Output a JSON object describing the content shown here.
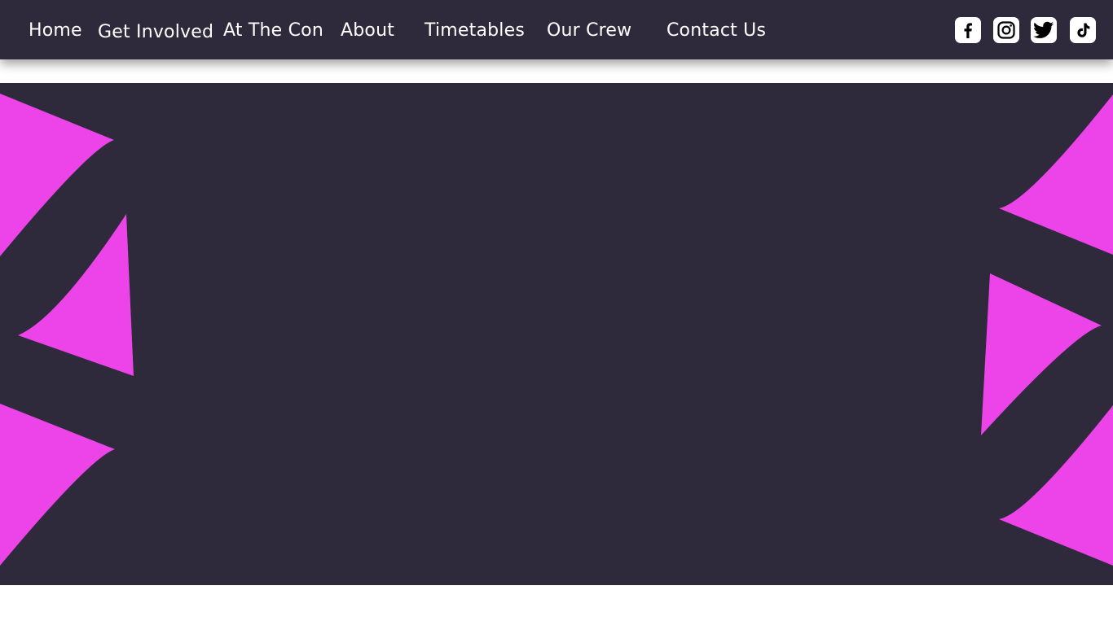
{
  "nav": {
    "items": [
      {
        "label": "Home"
      },
      {
        "label": "Get Involved"
      },
      {
        "label": "At The Con"
      },
      {
        "label": "About"
      },
      {
        "label": "Timetables"
      },
      {
        "label": "Our Crew"
      },
      {
        "label": "Contact Us"
      }
    ]
  },
  "social": [
    {
      "icon": "facebook-icon"
    },
    {
      "icon": "instagram-icon"
    },
    {
      "icon": "twitter-icon"
    },
    {
      "icon": "tiktok-icon"
    }
  ],
  "colors": {
    "header_bg": "#2e2a3b",
    "hero_bg": "#2e2a3b",
    "accent": "#ec44e8",
    "text": "#ffffff"
  }
}
